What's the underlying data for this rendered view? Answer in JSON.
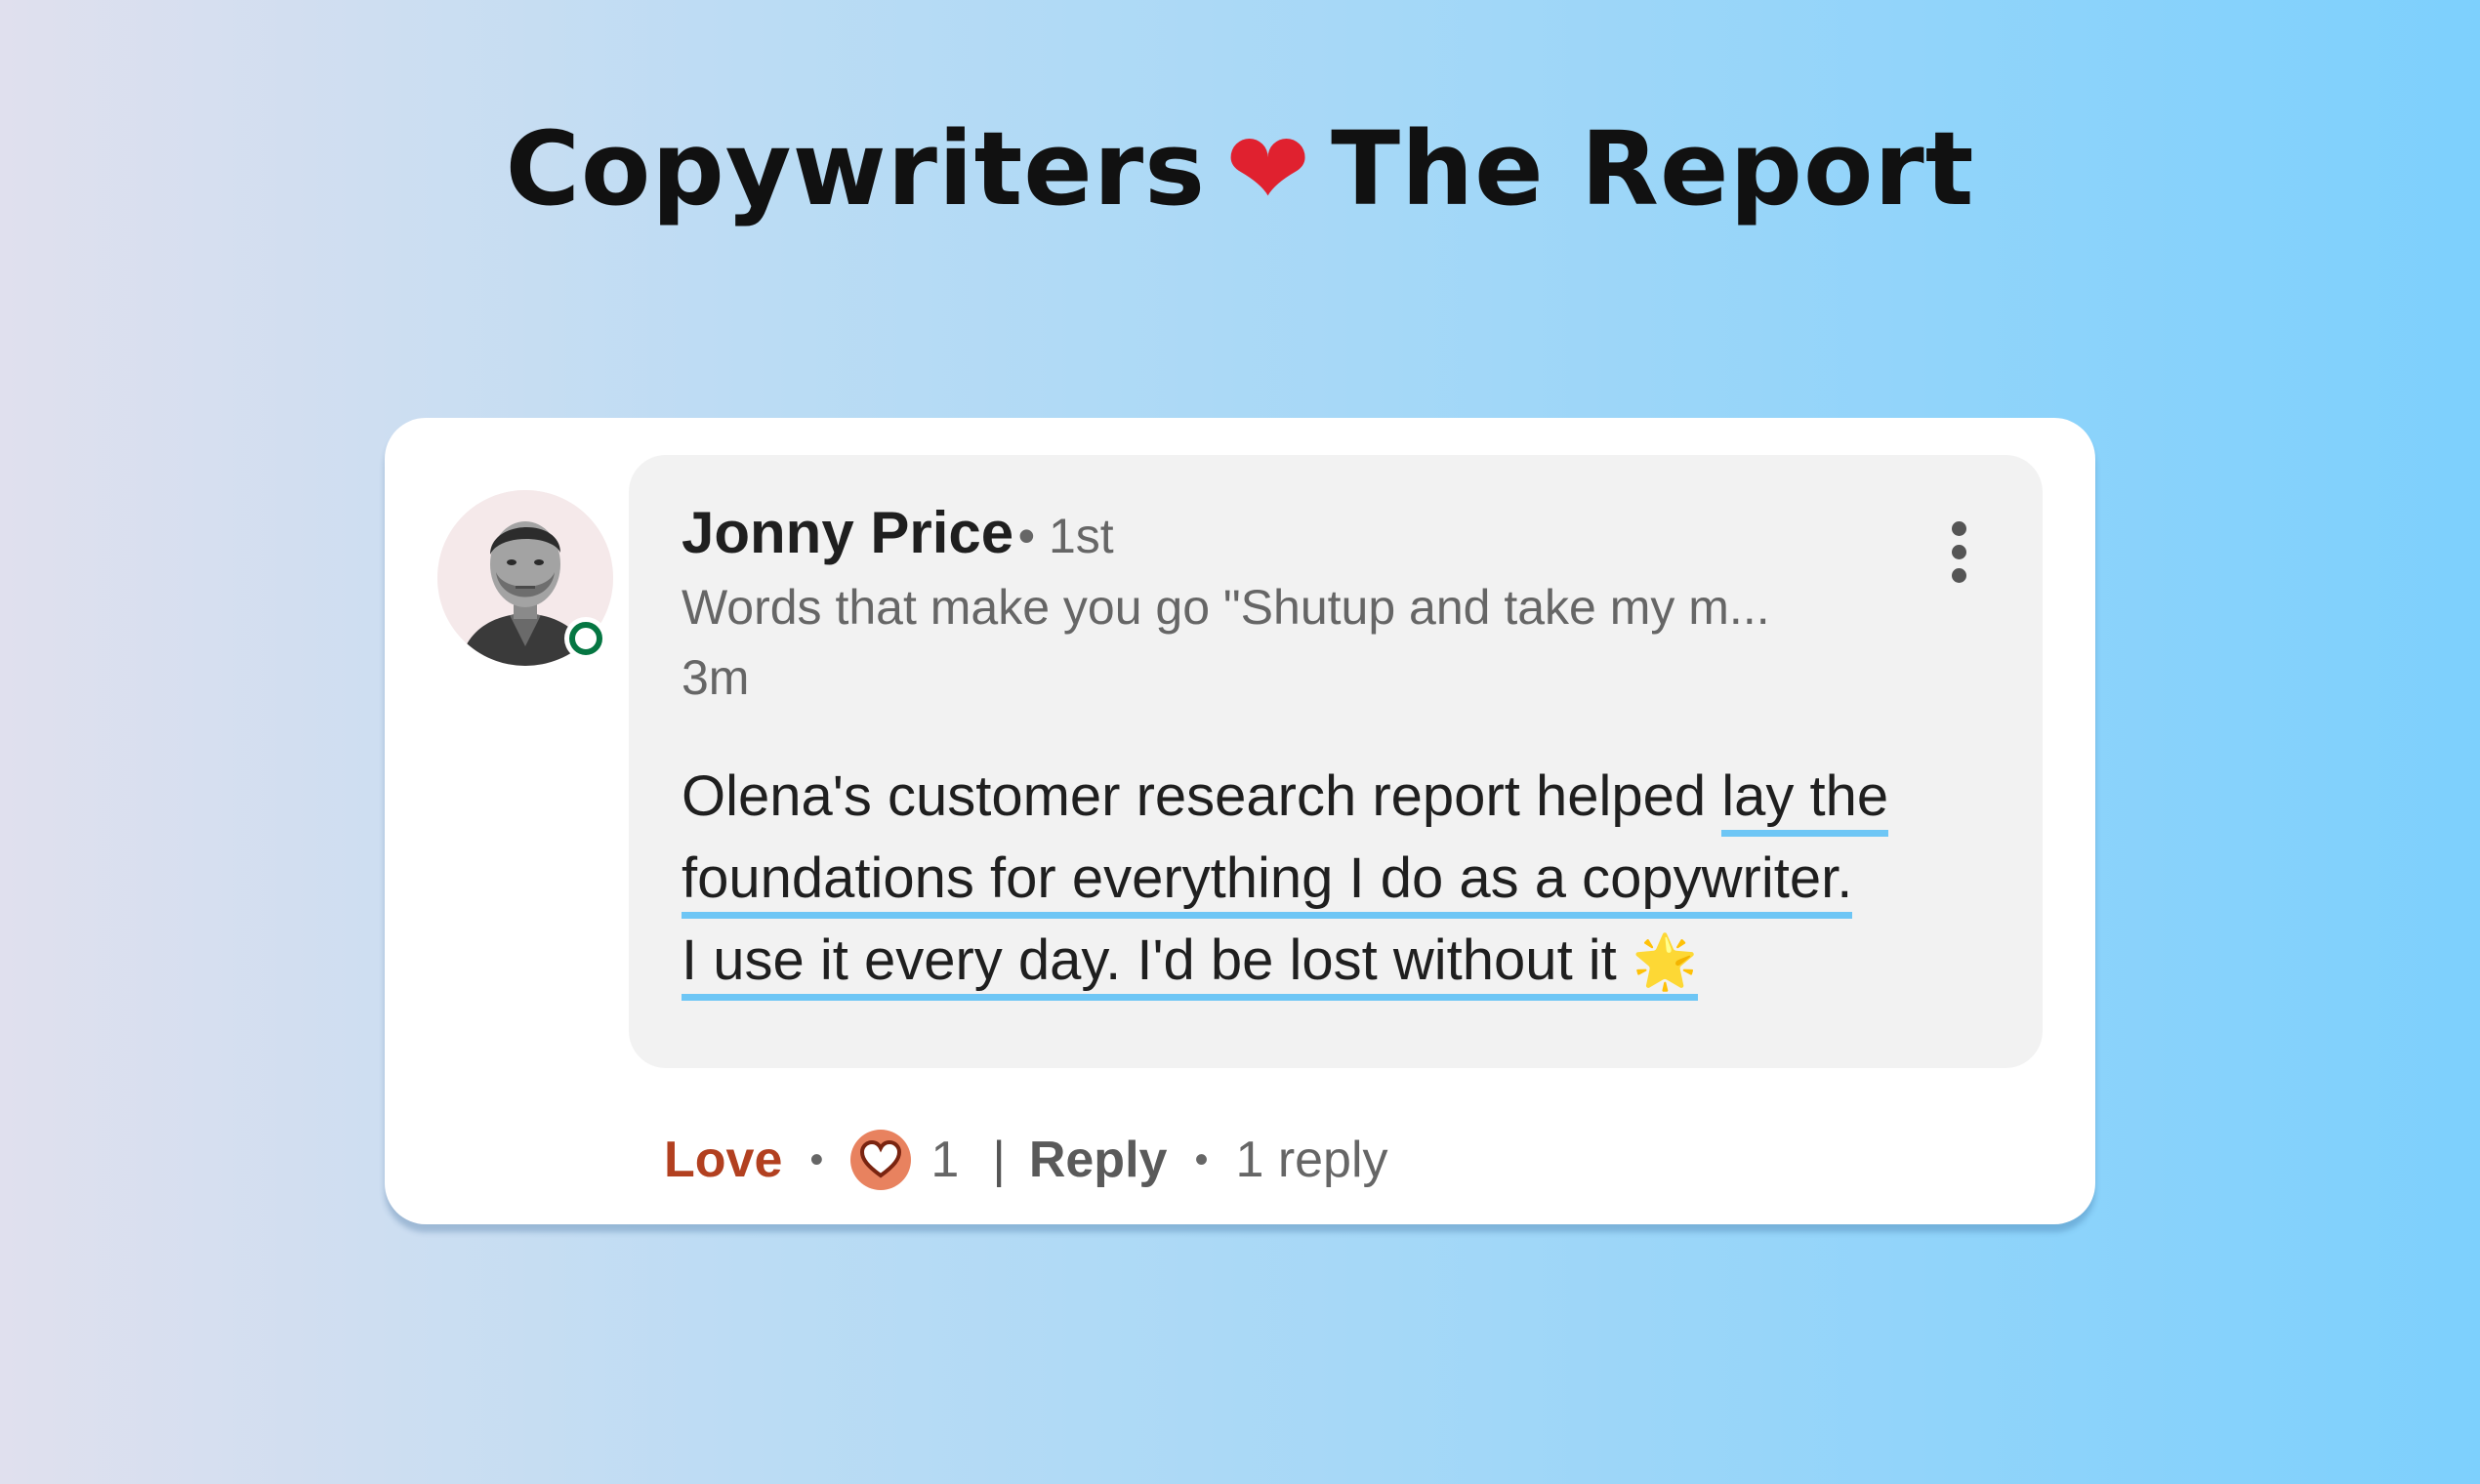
{
  "header": {
    "title_left": "Copywriters",
    "title_heart": "❤",
    "title_right": "The Report"
  },
  "comment": {
    "author": "Jonny Price",
    "degree": "• 1st",
    "author_headline": "Words that make you go \"Shutup and take my m...",
    "time": "3m",
    "body": {
      "line1_plain": "Olena's customer research report helped ",
      "line1_highlight": "lay the",
      "line2_highlight": "foundations for everything I do as a copywriter.",
      "line3_highlight": "I use it every day. I'd be lost without it",
      "emoji": "🌟"
    },
    "presence": "online"
  },
  "actions": {
    "love_label": "Love",
    "separator": "•",
    "reaction_count": "1",
    "divider": "|",
    "reply_label": "Reply",
    "replies_label": "1 reply"
  },
  "colors": {
    "love": "#b24020",
    "reaction_badge": "#e8825f",
    "highlight_underline": "#6ec6f5",
    "presence": "#057642",
    "heart": "#e0212f"
  }
}
